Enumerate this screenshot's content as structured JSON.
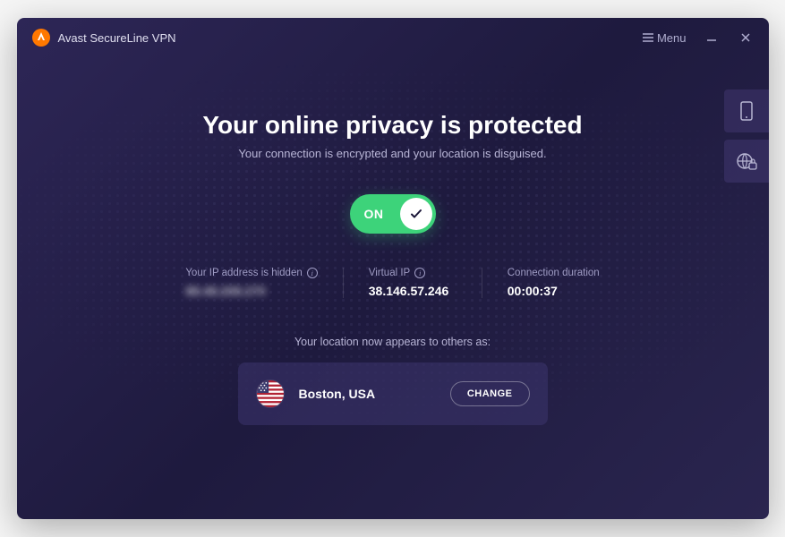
{
  "titlebar": {
    "app_title": "Avast SecureLine VPN",
    "menu_label": "Menu"
  },
  "main": {
    "headline": "Your online privacy is protected",
    "subtext": "Your connection is encrypted and your location is disguised.",
    "toggle_label": "ON"
  },
  "stats": {
    "ip_hidden": {
      "label": "Your IP address is hidden",
      "value": "88.48.208.270"
    },
    "virtual_ip": {
      "label": "Virtual IP",
      "value": "38.146.57.246"
    },
    "duration": {
      "label": "Connection duration",
      "value": "00:00:37"
    }
  },
  "location": {
    "caption": "Your location now appears to others as:",
    "name": "Boston, USA",
    "change_label": "CHANGE",
    "flag_country": "usa"
  },
  "icons": {
    "logo": "avast-logo",
    "hamburger": "hamburger-icon",
    "minimize": "minimize-icon",
    "close": "close-icon",
    "info": "info-icon",
    "check": "check-icon",
    "mobile": "mobile-icon",
    "globe_lock": "globe-lock-icon"
  },
  "colors": {
    "bg_gradient_from": "#2d2656",
    "bg_gradient_to": "#1e1a3e",
    "accent_green": "#3dd37a",
    "text_muted": "#b8b5d6",
    "avast_orange": "#ff7800"
  }
}
